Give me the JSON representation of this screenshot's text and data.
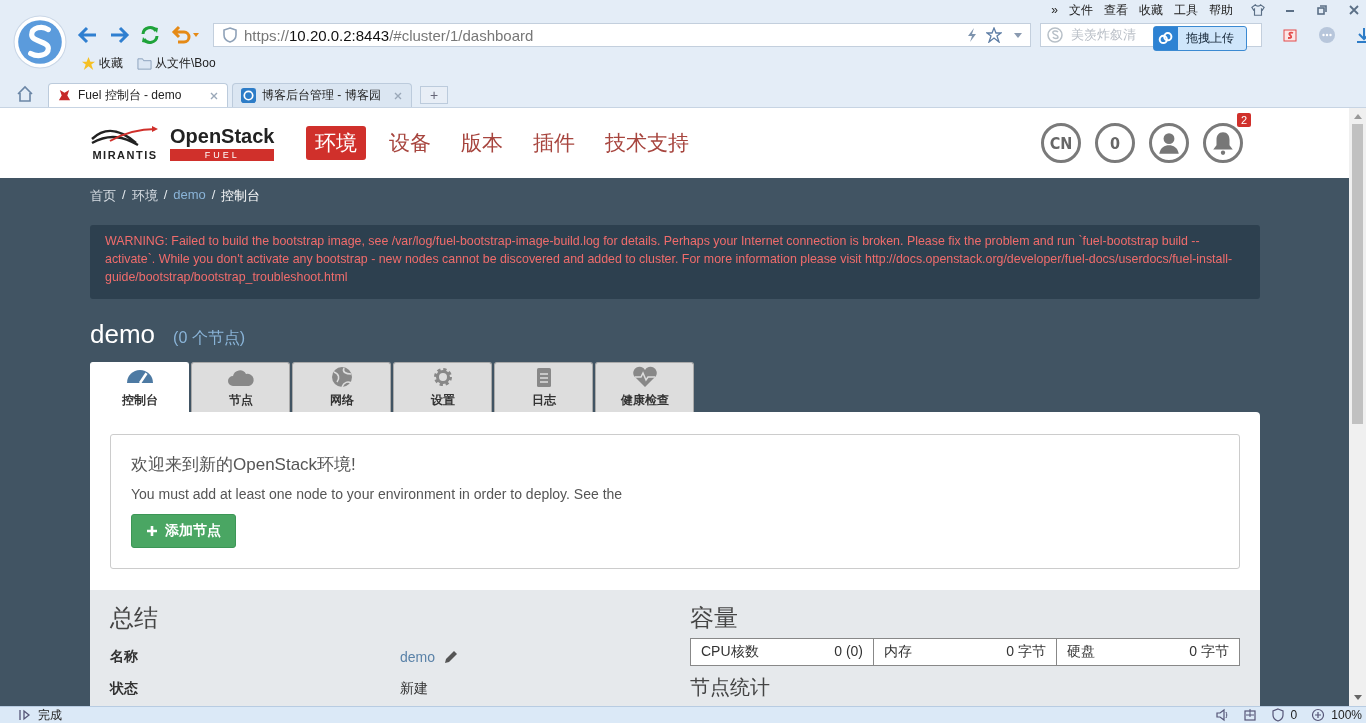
{
  "browser": {
    "more": "»",
    "menu": [
      "文件",
      "查看",
      "收藏",
      "工具",
      "帮助"
    ],
    "address": {
      "scheme": "https://",
      "host": "10.20.0.2:8443",
      "path": "/#cluster/1/dashboard"
    },
    "search": {
      "placeholder": "美羡炸叙清"
    },
    "upload_button": "拖拽上传",
    "bookmarks": [
      {
        "label": "收藏",
        "kind": "star"
      },
      {
        "label": "从文件\\Boo",
        "kind": "folder"
      }
    ],
    "tabs": [
      {
        "title": "Fuel 控制台 - demo",
        "selected": true
      },
      {
        "title": "博客后台管理 - 博客园",
        "selected": false
      }
    ],
    "new_tab": "+"
  },
  "header": {
    "logo": {
      "brand": "MIRANTIS",
      "product": "OpenStack",
      "sub": "FUEL"
    },
    "nav": [
      {
        "label": "环境",
        "selected": true
      },
      {
        "label": "设备",
        "selected": false
      },
      {
        "label": "版本",
        "selected": false
      },
      {
        "label": "插件",
        "selected": false
      },
      {
        "label": "技术支持",
        "selected": false
      }
    ],
    "language": "CN",
    "node_count": "0",
    "notifications": "2"
  },
  "breadcrumb": [
    {
      "label": "首页",
      "kind": "plain"
    },
    {
      "separator": "/",
      "label": "环境",
      "kind": "plain"
    },
    {
      "separator": "/",
      "label": "demo",
      "kind": "link"
    },
    {
      "separator": "/",
      "label": "控制台",
      "kind": "current"
    }
  ],
  "warning": "WARNING: Failed to build the bootstrap image, see /var/log/fuel-bootstrap-image-build.log for details. Perhaps your Internet connection is broken. Please fix the problem and run `fuel-bootstrap build --activate`. While you don't activate any bootstrap - new nodes cannot be discovered and added to cluster. For more information please visit http://docs.openstack.org/developer/fuel-docs/userdocs/fuel-install-guide/bootstrap/bootstrap_troubleshoot.html",
  "cluster": {
    "name": "demo",
    "count": "(0 个节点)"
  },
  "tabs": [
    {
      "label": "控制台",
      "kind": "dashboard",
      "selected": true
    },
    {
      "label": "节点",
      "kind": "cloud",
      "selected": false
    },
    {
      "label": "网络",
      "kind": "globe",
      "selected": false
    },
    {
      "label": "设置",
      "kind": "gear",
      "selected": false
    },
    {
      "label": "日志",
      "kind": "clipboard",
      "selected": false
    },
    {
      "label": "健康检查",
      "kind": "heart",
      "selected": false
    }
  ],
  "welcome": {
    "title": "欢迎来到新的OpenStack环境!",
    "text": "You must add at least one node to your environment in order to deploy. See the",
    "button": "添加节点"
  },
  "summary": {
    "title": "总结",
    "rows": [
      {
        "label": "名称",
        "value": "demo",
        "kind": "editable"
      },
      {
        "label": "状态",
        "value": "新建",
        "kind": "text"
      }
    ]
  },
  "capacity": {
    "title": "容量",
    "items": [
      {
        "label": "CPU核数",
        "value": "0 (0)"
      },
      {
        "label": "内存",
        "value": "0 字节"
      },
      {
        "label": "硬盘",
        "value": "0 字节"
      }
    ]
  },
  "stats": {
    "title": "节点统计"
  },
  "status_bar": {
    "text": "完成",
    "count": "0",
    "zoom": "100%"
  }
}
